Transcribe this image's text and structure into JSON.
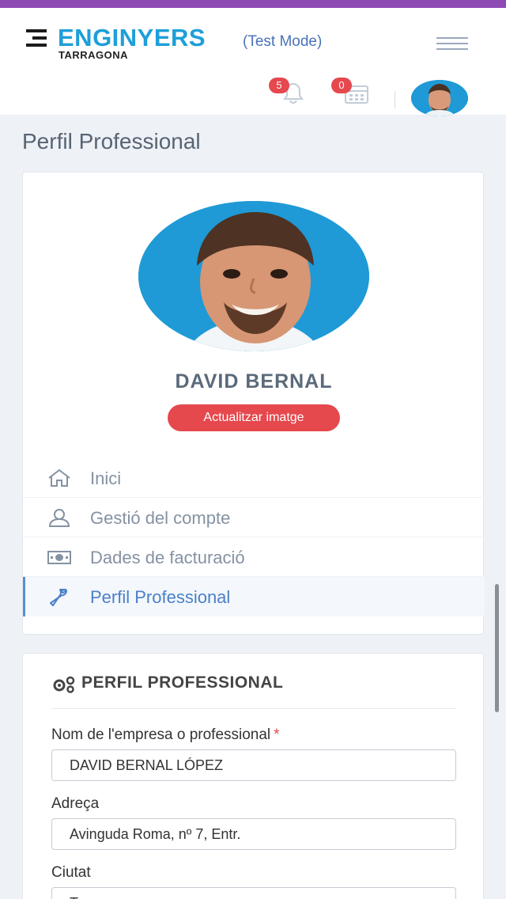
{
  "header": {
    "brand": "ENGINYERS",
    "sub": "TARRAGONA",
    "mode": "(Test Mode)",
    "notifications_count": "5",
    "calendar_count": "0",
    "icons": {
      "menu": "hamburger-icon",
      "bell": "bell-icon",
      "calendar": "calendar-icon"
    }
  },
  "page": {
    "title": "Perfil Professional"
  },
  "profile": {
    "name": "DAVID BERNAL",
    "update_button": "Actualitzar imatge"
  },
  "nav": {
    "items": [
      {
        "label": "Inici",
        "icon": "home-icon",
        "active": false
      },
      {
        "label": "Gestió del compte",
        "icon": "user-icon",
        "active": false
      },
      {
        "label": "Dades de facturació",
        "icon": "money-icon",
        "active": false
      },
      {
        "label": "Perfil Professional",
        "icon": "wrench-icon",
        "active": true
      }
    ]
  },
  "form": {
    "title": "PERFIL PROFESSIONAL",
    "icon": "gears-icon",
    "fields": [
      {
        "label": "Nom de l'empresa o professional",
        "required": "*",
        "value": "DAVID BERNAL LÓPEZ"
      },
      {
        "label": "Adreça",
        "value": "Avinguda Roma, nº 7, Entr."
      },
      {
        "label": "Ciutat",
        "value": "T"
      }
    ]
  },
  "colors": {
    "accent": "#1e9fd9",
    "topbar": "#8e4bb4",
    "danger": "#e5484d",
    "active_nav": "#4a80c8"
  }
}
